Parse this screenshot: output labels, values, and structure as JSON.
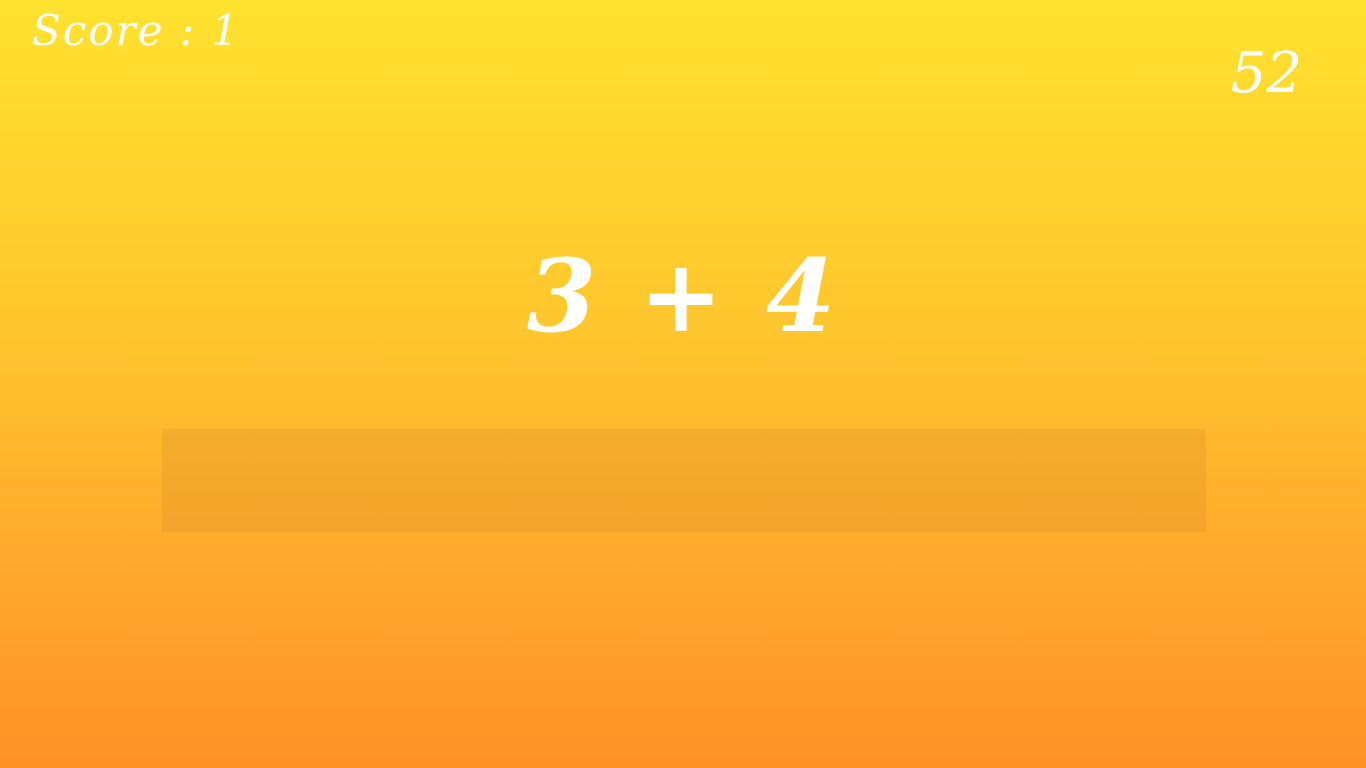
{
  "hud": {
    "score_text": "Score : 1",
    "timer": "52"
  },
  "problem": {
    "expression": "3 + 4"
  },
  "answer": {
    "value": "",
    "placeholder": ""
  },
  "colors": {
    "gradient_top": "#ffe22f",
    "gradient_bottom": "#ff9227",
    "text": "#ffffff"
  }
}
